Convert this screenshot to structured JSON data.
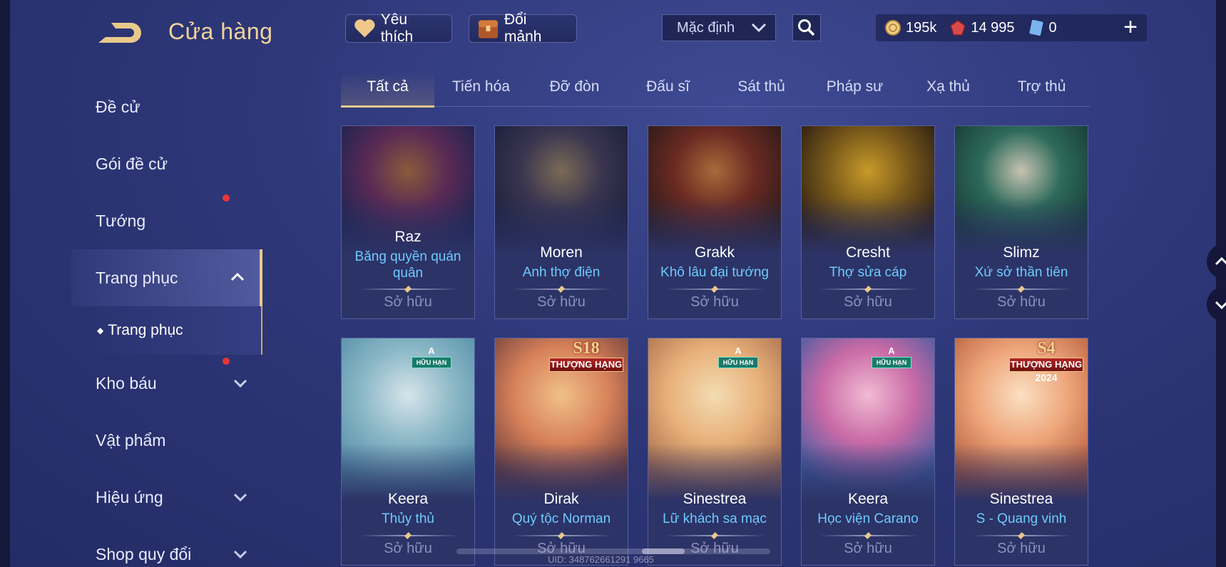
{
  "header": {
    "title": "Cửa hàng",
    "favorites_label": "Yêu thích",
    "exchange_label": "Đổi mảnh",
    "sort_selected": "Mặc định"
  },
  "currency": {
    "gold": "195k",
    "gems": "14 995",
    "vouchers": "0"
  },
  "sidebar": {
    "items": [
      {
        "label": "Đề cử"
      },
      {
        "label": "Gói đề cử"
      },
      {
        "label": "Tướng"
      },
      {
        "label": "Trang phục"
      },
      {
        "label": "Kho báu"
      },
      {
        "label": "Vật phẩm"
      },
      {
        "label": "Hiệu ứng"
      },
      {
        "label": "Shop quy đổi"
      }
    ],
    "subitem": "Trang phục"
  },
  "tabs": [
    "Tất cả",
    "Tiến hóa",
    "Đỡ đòn",
    "Đấu sĩ",
    "Sát thủ",
    "Pháp sư",
    "Xạ thủ",
    "Trợ thủ"
  ],
  "cards": [
    {
      "hero": "Raz",
      "skin_line1": "Băng quyền quán",
      "skin_line2": "quân",
      "status": "Sở hữu",
      "palette": [
        "#1b2350",
        "#5a2a55",
        "#8a5a3a"
      ]
    },
    {
      "hero": "Moren",
      "skin_line1": "Anh thợ điện",
      "skin_line2": "",
      "status": "Sở hữu",
      "palette": [
        "#1a1f3a",
        "#3a3550",
        "#7a6a55"
      ]
    },
    {
      "hero": "Grakk",
      "skin_line1": "Khô lâu đại tướng",
      "skin_line2": "",
      "status": "Sở hữu",
      "palette": [
        "#2a1a18",
        "#6a2a22",
        "#a86a3a"
      ]
    },
    {
      "hero": "Cresht",
      "skin_line1": "Thợ sửa cáp",
      "skin_line2": "",
      "status": "Sở hữu",
      "palette": [
        "#2a1c12",
        "#7a5a1a",
        "#c89a2a"
      ]
    },
    {
      "hero": "Slimz",
      "skin_line1": "Xứ sở thần tiên",
      "skin_line2": "",
      "status": "Sở hữu",
      "palette": [
        "#173a36",
        "#2e6a5a",
        "#c7c3b2"
      ]
    },
    {
      "hero": "Keera",
      "skin_line1": "Thủy thủ",
      "skin_line2": "",
      "status": "Sở hữu",
      "palette": [
        "#4f8aa6",
        "#8ab7c6",
        "#d6e4ea"
      ],
      "badge_top": "A",
      "badge_bottom": "HỮU HẠN"
    },
    {
      "hero": "Dirak",
      "skin_line1": "Quý tộc Norman",
      "skin_line2": "",
      "status": "Sở hữu",
      "palette": [
        "#6a3a3a",
        "#d8825a",
        "#f0c08a"
      ],
      "badge_top": "S18",
      "badge_bottom": "THƯỢNG HẠNG"
    },
    {
      "hero": "Sinestrea",
      "skin_line1": "Lữ khách sa mạc",
      "skin_line2": "",
      "status": "Sở hữu",
      "palette": [
        "#a56a4a",
        "#e8b07a",
        "#f3dcb2"
      ],
      "badge_top": "A",
      "badge_bottom": "HỮU HẠN"
    },
    {
      "hero": "Keera",
      "skin_line1": "Học viện Carano",
      "skin_line2": "",
      "status": "Sở hữu",
      "palette": [
        "#3a5aa0",
        "#c86aa6",
        "#f2bad2"
      ],
      "badge_top": "A",
      "badge_bottom": "HỮU HẠN"
    },
    {
      "hero": "Sinestrea",
      "skin_line1": "S - Quang vinh",
      "skin_line2": "",
      "status": "Sở hữu",
      "palette": [
        "#b25a3a",
        "#eea57a",
        "#fae0c2"
      ],
      "badge_top": "S4",
      "badge_bottom": "THƯỢNG HẠNG",
      "badge_year": "2024"
    }
  ],
  "footer_uid": "UID: 348762661291 9665"
}
